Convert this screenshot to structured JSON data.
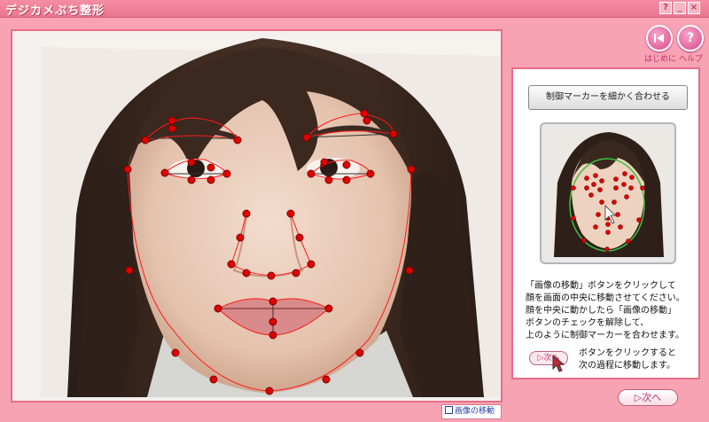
{
  "window": {
    "title": "デジカメぷち整形"
  },
  "window_buttons": {
    "help": "?",
    "minimize": "_",
    "close": "×"
  },
  "top_buttons": {
    "start_label": "はじめに",
    "help_label": "ヘルプ"
  },
  "main": {
    "move_image_checkbox": "画像の移動",
    "move_image_checked": false
  },
  "panel": {
    "fine_adjust_button": "制御マーカーを細かく合わせる",
    "instructions": [
      "「画像の移動」ボタンをクリックして",
      "顔を画面の中央に移動させてください。",
      "顔を中央に動かしたら「画像の移動」",
      "ボタンのチェックを解除して、",
      "上のように制御マーカーを合わせます。"
    ],
    "next_hint_button": "次へ",
    "next_hint_lines": [
      "ボタンをクリックすると",
      "次の過程に移動します。"
    ]
  },
  "footer": {
    "next_button": "次へ"
  },
  "colors": {
    "accent": "#e86c88",
    "marker": "#e00000",
    "outline": "#ff1a1a",
    "thumb_outline": "#3fbf3f"
  }
}
